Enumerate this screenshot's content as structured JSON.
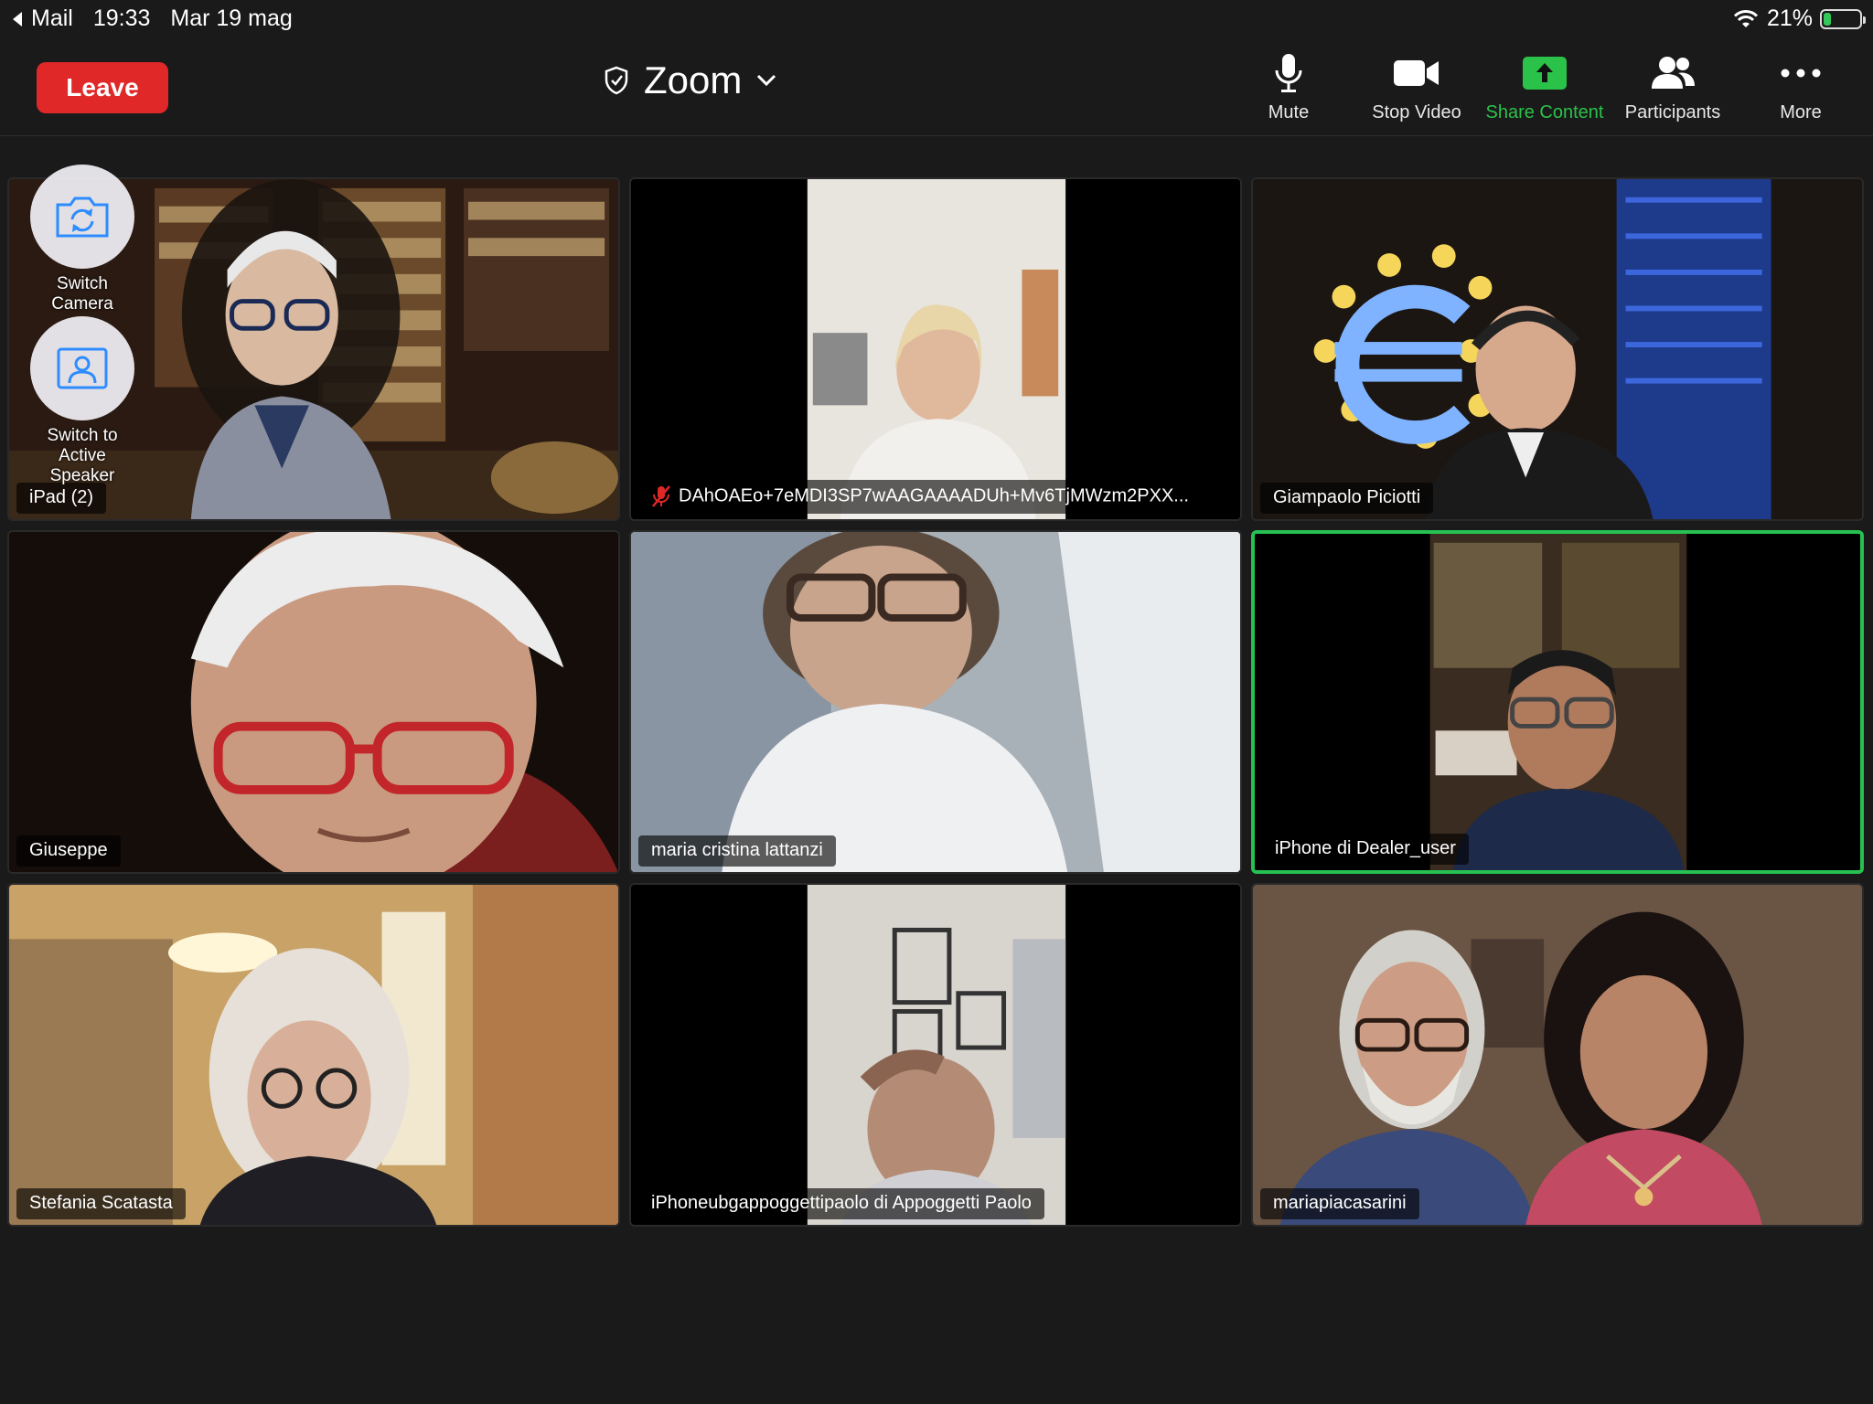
{
  "status_bar": {
    "back_app": "Mail",
    "time": "19:33",
    "date": "Mar 19 mag",
    "battery": "21%",
    "battery_level": 0.21
  },
  "toolbar": {
    "leave_label": "Leave",
    "meeting_title": "Zoom",
    "buttons": {
      "mute": "Mute",
      "stop_video": "Stop Video",
      "share_content": "Share Content",
      "participants": "Participants",
      "more": "More"
    }
  },
  "overlay": {
    "switch_camera": "Switch Camera",
    "switch_speaker_line1": "Switch to",
    "switch_speaker_line2": "Active Speaker"
  },
  "participants": [
    {
      "name": "iPad (2)"
    },
    {
      "name": "DAhOAEo+7eMDI3SP7wAAGAAAADUh+Mv6TjMWzm2PXX...",
      "muted": true
    },
    {
      "name": "Giampaolo Piciotti"
    },
    {
      "name": "Giuseppe"
    },
    {
      "name": "maria cristina lattanzi"
    },
    {
      "name": "iPhone di Dealer_user",
      "active_speaker": true
    },
    {
      "name": "Stefania Scatasta"
    },
    {
      "name": "iPhoneubgappoggettipaolo di Appoggetti Paolo"
    },
    {
      "name": "mariapiacasarini"
    }
  ],
  "colors": {
    "leave": "#e02828",
    "active_border": "#26c152",
    "share_green": "#2bc24a"
  }
}
